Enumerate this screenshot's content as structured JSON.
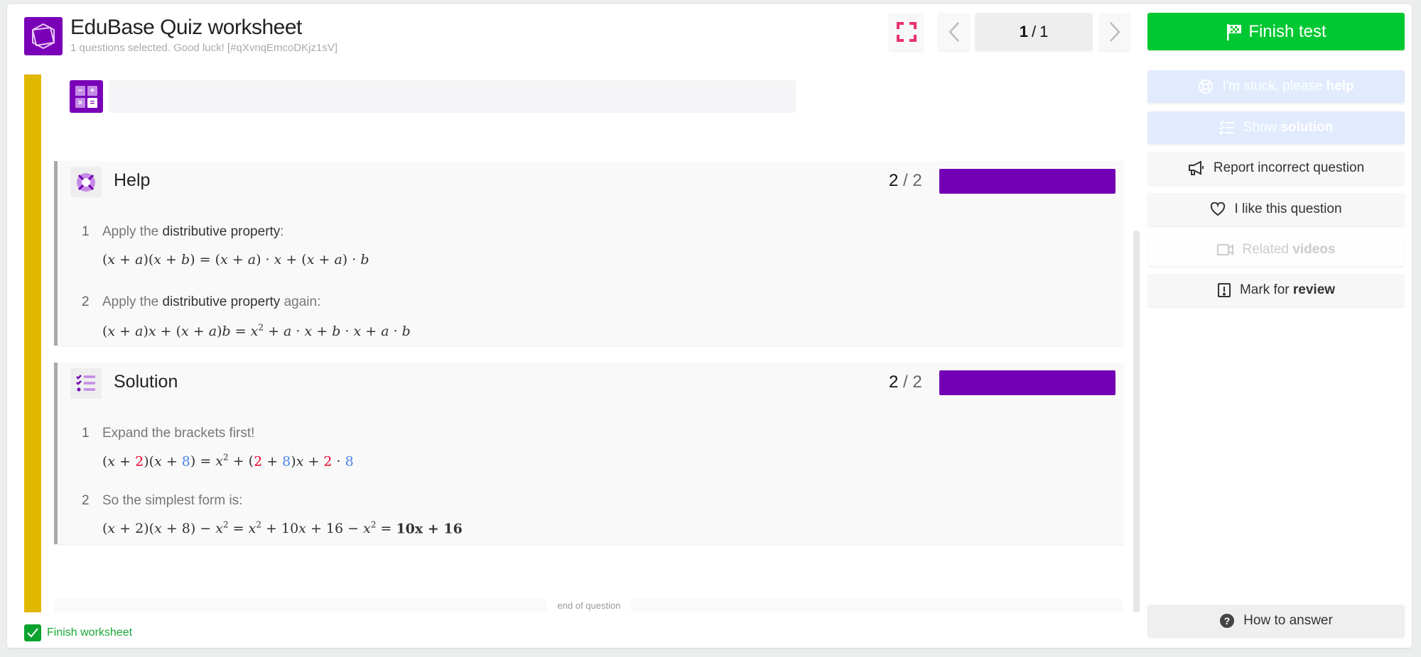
{
  "header": {
    "title": "EduBase Quiz worksheet",
    "subtitle": "1 questions selected. Good luck!  [#qXvnqEmcoDKjz1sV]",
    "page_current": "1",
    "page_sep": "/",
    "page_total": "1",
    "finish_label": "Finish test"
  },
  "side": {
    "stuck": {
      "pre": "I'm stuck, please ",
      "bold": "help"
    },
    "solution": {
      "pre": "Show ",
      "bold": "solution"
    },
    "report": {
      "pre": "Report incorrect question",
      "bold": ""
    },
    "like": {
      "pre": "I like this question",
      "bold": ""
    },
    "videos": {
      "pre": "Related ",
      "bold": "videos"
    },
    "review": {
      "pre": "Mark for ",
      "bold": "review"
    },
    "how": "How to answer"
  },
  "calc_keys": [
    "−",
    "+",
    "×",
    "="
  ],
  "help": {
    "title": "Help",
    "count": "2",
    "total": "2",
    "progress": 1.0,
    "steps": [
      {
        "num": "1",
        "text": [
          [
            "Apply the ",
            0
          ],
          [
            "distributive property",
            1
          ],
          [
            ":",
            0
          ]
        ],
        "math": [
          [
            "(x + a)(x + b) = (x + a) · x + (x + a) · b",
            ""
          ]
        ]
      },
      {
        "num": "2",
        "text": [
          [
            "Apply the ",
            0
          ],
          [
            "distributive property",
            1
          ],
          [
            " again:",
            0
          ]
        ],
        "math": [
          [
            "(x + a)x + (x + a)b = x^2 + a · x + b · x + a · b",
            ""
          ]
        ]
      }
    ]
  },
  "solution": {
    "title": "Solution",
    "count": "2",
    "total": "2",
    "progress": 1.0,
    "steps": [
      {
        "num": "1",
        "text": [
          [
            "Expand the brackets first!",
            0
          ]
        ],
        "math": [
          [
            "(x + ",
            ""
          ],
          [
            "2",
            "#e8002b"
          ],
          [
            ")(x + ",
            ""
          ],
          [
            "8",
            "#4a86e8"
          ],
          [
            ") = x^2 + (",
            ""
          ],
          [
            "2",
            "#e8002b"
          ],
          [
            " + ",
            ""
          ],
          [
            "8",
            "#4a86e8"
          ],
          [
            ")x + ",
            ""
          ],
          [
            "2",
            "#e8002b"
          ],
          [
            " · ",
            ""
          ],
          [
            "8",
            "#4a86e8"
          ]
        ]
      },
      {
        "num": "2",
        "text": [
          [
            "So the simplest form is:",
            0
          ]
        ],
        "math": [
          [
            "(x + 2)(x + 8) − x^2 = x^2 + 10x + 16 − x^2 = ",
            ""
          ],
          [
            "10x + 16",
            "bold"
          ]
        ]
      }
    ]
  },
  "footer": {
    "end_label": "end of question",
    "finish_worksheet": "Finish worksheet"
  },
  "colors": {
    "accent": "#7a00b8",
    "finish": "#00c832",
    "yellow": "#e0b800",
    "red": "#e8002b",
    "blue": "#4a86e8"
  }
}
